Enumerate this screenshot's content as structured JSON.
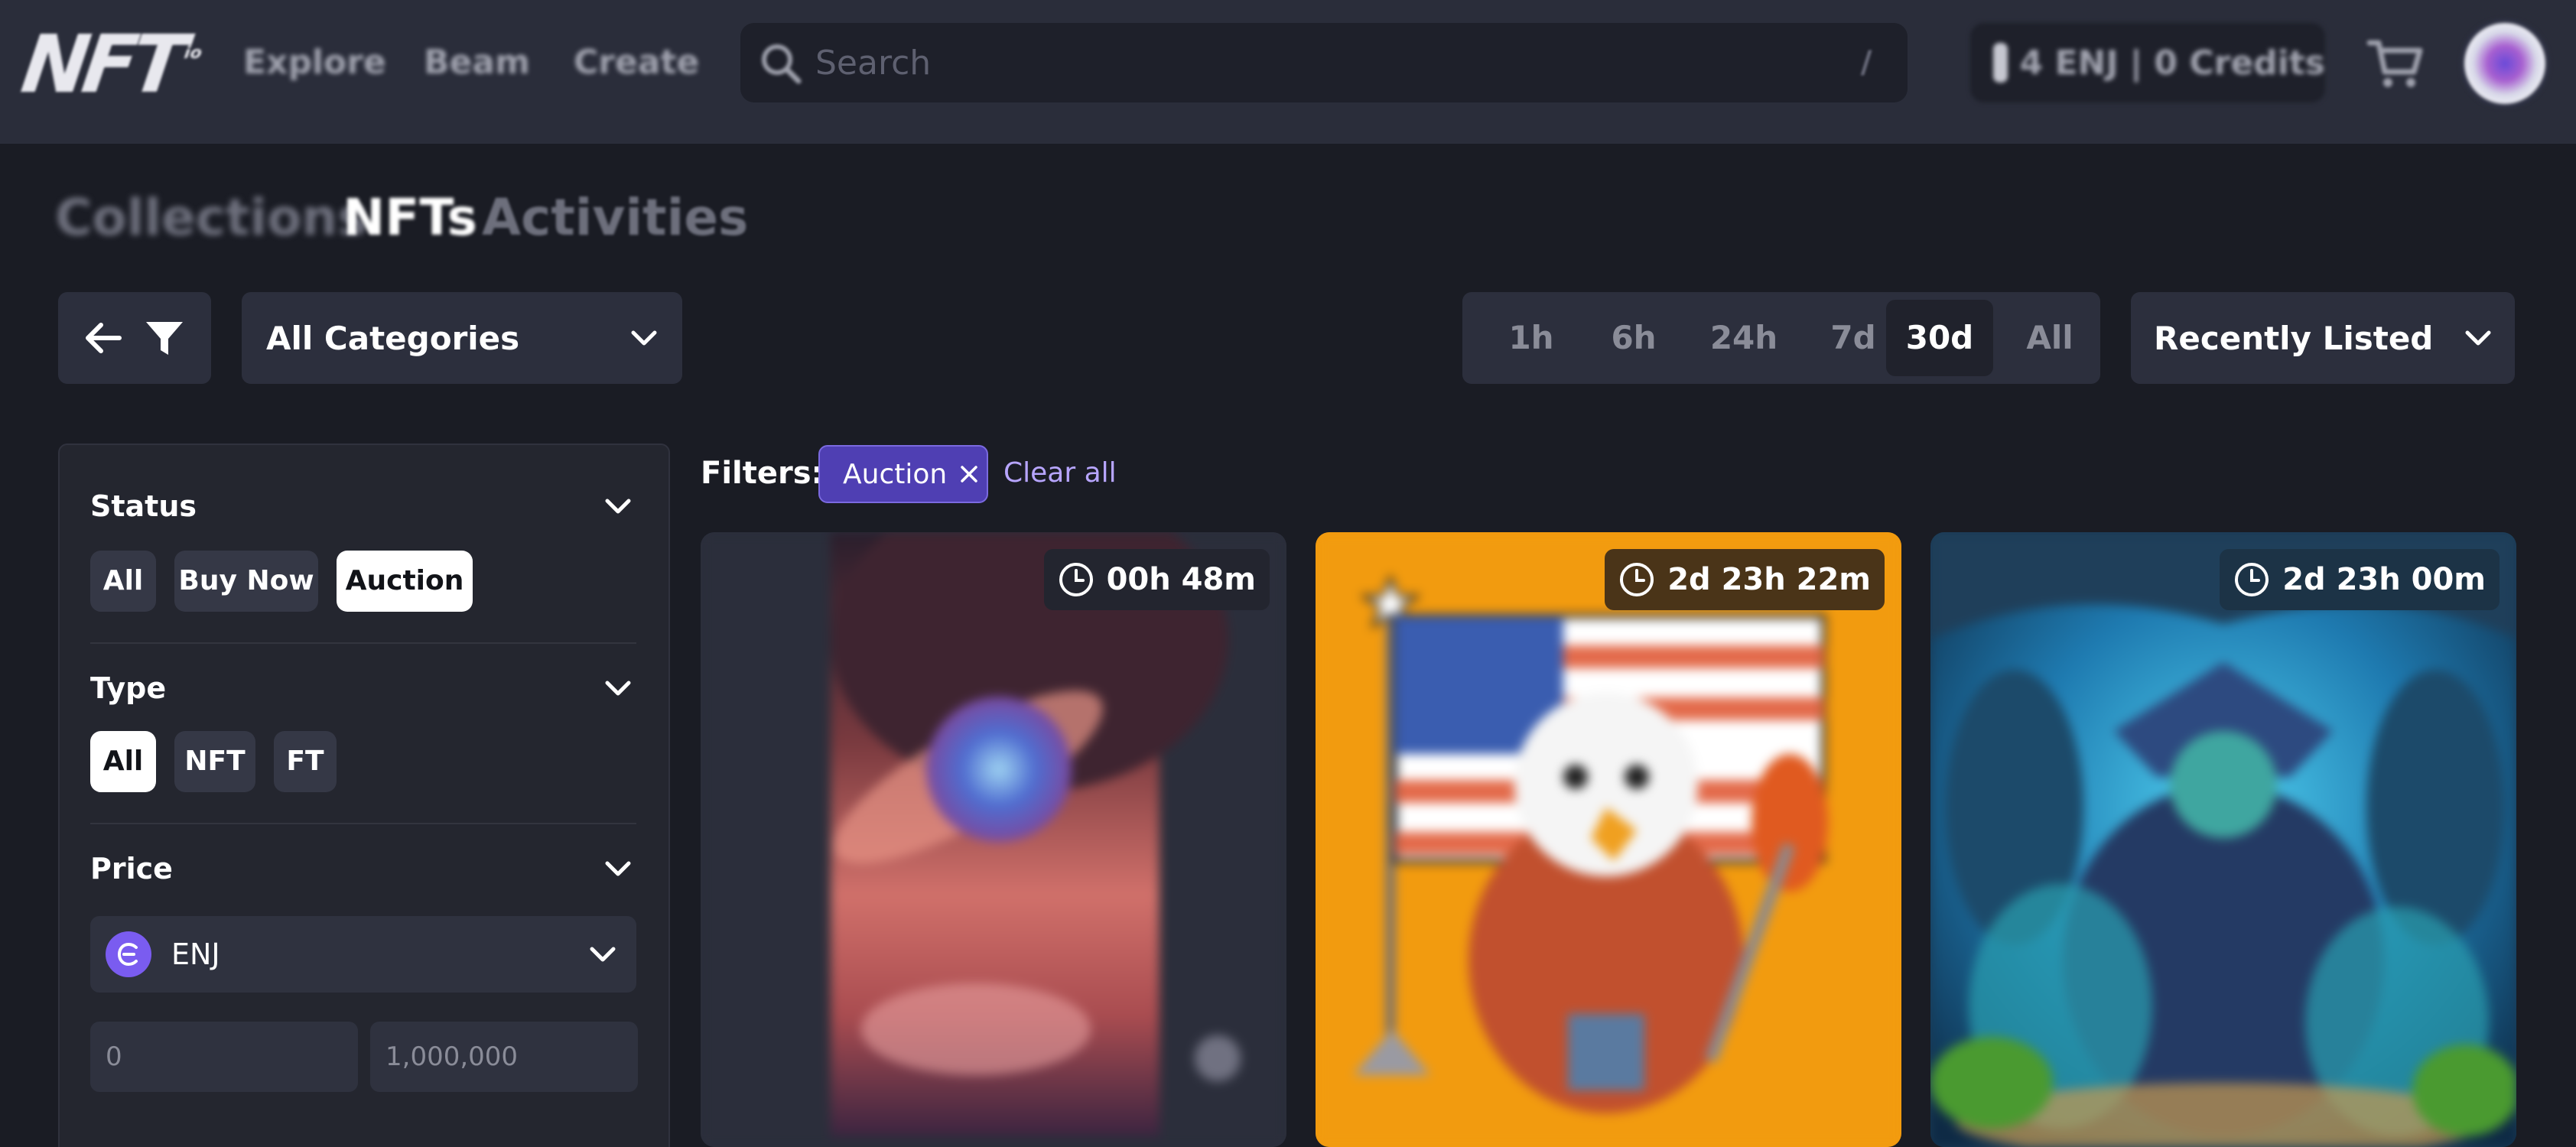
{
  "header": {
    "logo_text": "NFT",
    "logo_suffix": "io",
    "nav": [
      {
        "label": "Explore"
      },
      {
        "label": "Beam"
      },
      {
        "label": "Create"
      }
    ],
    "search": {
      "placeholder": "Search",
      "shortcut": "/"
    },
    "wallet": {
      "label": "4 ENJ | 0 Credits"
    }
  },
  "tabs": [
    {
      "label": "Collections",
      "active": false
    },
    {
      "label": "NFTs",
      "active": true
    },
    {
      "label": "Activities",
      "active": false
    }
  ],
  "toolbar": {
    "category": "All Categories",
    "time_ranges": [
      {
        "label": "1h",
        "active": false
      },
      {
        "label": "6h",
        "active": false
      },
      {
        "label": "24h",
        "active": false
      },
      {
        "label": "7d",
        "active": false
      },
      {
        "label": "30d",
        "active": true
      },
      {
        "label": "All",
        "active": false
      }
    ],
    "sort": "Recently Listed"
  },
  "sidebar": {
    "status": {
      "title": "Status",
      "options": [
        {
          "label": "All",
          "active": false
        },
        {
          "label": "Buy Now",
          "active": false
        },
        {
          "label": "Auction",
          "active": true
        }
      ]
    },
    "type": {
      "title": "Type",
      "options": [
        {
          "label": "All",
          "active": true
        },
        {
          "label": "NFT",
          "active": false
        },
        {
          "label": "FT",
          "active": false
        }
      ]
    },
    "price": {
      "title": "Price",
      "currency": "ENJ",
      "min_placeholder": "0",
      "max_placeholder": "1,000,000"
    }
  },
  "filters": {
    "label": "Filters:",
    "active": [
      {
        "label": "Auction"
      }
    ],
    "clear_label": "Clear all"
  },
  "cards": [
    {
      "time_left": "00h 48m",
      "art_icon": "planet-artwork"
    },
    {
      "time_left": "2d 23h 22m",
      "art_icon": "eagle-flag-artwork"
    },
    {
      "time_left": "2d 23h 00m",
      "art_icon": "forest-goblin-artwork"
    }
  ],
  "colors": {
    "background": "#1a1c24",
    "topbar": "#2a2d3a",
    "accent_purple": "#4f3fb3",
    "link_purple": "#b7a5ff",
    "enj_badge": "#7a5cf0"
  }
}
